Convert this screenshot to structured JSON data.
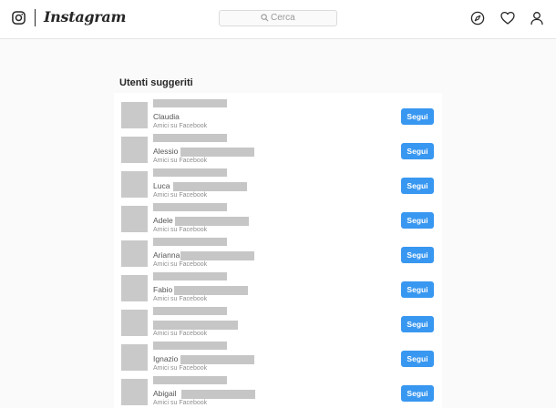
{
  "header": {
    "brand": "Instagram",
    "search_placeholder": "Cerca",
    "icons": [
      "instagram-glyph-icon",
      "search-icon",
      "explore-compass-icon",
      "activity-heart-icon",
      "profile-icon"
    ]
  },
  "section_title": "Utenti suggeriti",
  "follow_label": "Segui",
  "users": [
    {
      "name": "Claudia",
      "subtitle": "Amici su Facebook"
    },
    {
      "name": "Alessio",
      "subtitle": "Amici su Facebook"
    },
    {
      "name": "Luca",
      "subtitle": "Amici su Facebook"
    },
    {
      "name": "Adele",
      "subtitle": "Amici su Facebook"
    },
    {
      "name": "Arianna",
      "subtitle": "Amici su Facebook"
    },
    {
      "name": "Fabio",
      "subtitle": "Amici su Facebook"
    },
    {
      "name": "",
      "subtitle": "Amici su Facebook"
    },
    {
      "name": "Ignazio",
      "subtitle": "Amici su Facebook"
    },
    {
      "name": "Abigail",
      "subtitle": "Amici su Facebook"
    }
  ],
  "colors": {
    "accent": "#3897f0",
    "redaction": "#c6c6c6",
    "background": "#fafafa"
  }
}
